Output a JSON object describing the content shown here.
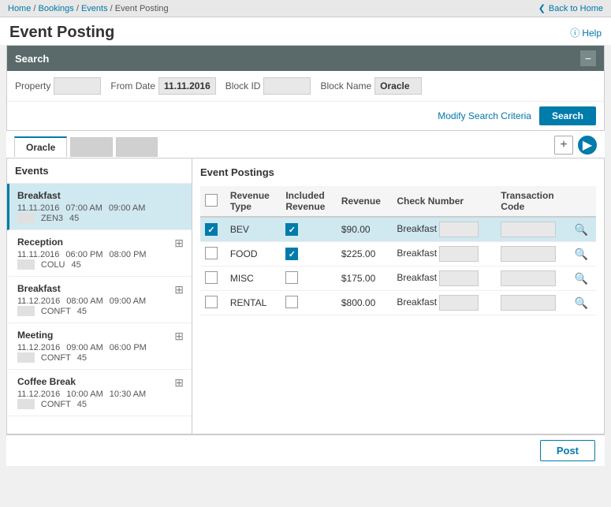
{
  "breadcrumb": {
    "items": [
      "Home",
      "Bookings",
      "Events",
      "Event Posting"
    ]
  },
  "back_to_home": "Back to Home",
  "page_title": "Event Posting",
  "help_label": "Help",
  "search_section": {
    "title": "Search",
    "property_label": "Property",
    "property_value": "",
    "from_date_label": "From Date",
    "from_date_value": "11.11.2016",
    "block_id_label": "Block ID",
    "block_id_value": "",
    "block_name_label": "Block Name",
    "block_name_value": "Oracle",
    "modify_link": "Modify Search Criteria",
    "search_btn": "Search"
  },
  "tabs": [
    {
      "label": "Oracle",
      "active": true
    },
    {
      "label": "",
      "active": false
    },
    {
      "label": "",
      "active": false
    }
  ],
  "events_title": "Events",
  "events": [
    {
      "name": "Breakfast",
      "date": "11.11.2016",
      "start_time": "07:00 AM",
      "end_time": "09:00 AM",
      "code": "ZEN3",
      "num": "45",
      "active": true,
      "has_icon": false
    },
    {
      "name": "Reception",
      "date": "11.11.2016",
      "start_time": "06:00 PM",
      "end_time": "08:00 PM",
      "code": "COLU",
      "num": "45",
      "active": false,
      "has_icon": true
    },
    {
      "name": "Breakfast",
      "date": "11.12.2016",
      "start_time": "08:00 AM",
      "end_time": "09:00 AM",
      "code": "CONFT",
      "num": "45",
      "active": false,
      "has_icon": true
    },
    {
      "name": "Meeting",
      "date": "11.12.2016",
      "start_time": "09:00 AM",
      "end_time": "06:00 PM",
      "code": "CONFT",
      "num": "45",
      "active": false,
      "has_icon": true
    },
    {
      "name": "Coffee Break",
      "date": "11.12.2016",
      "start_time": "10:00 AM",
      "end_time": "10:30 AM",
      "code": "CONFT",
      "num": "45",
      "active": false,
      "has_icon": true
    }
  ],
  "postings_title": "Event Postings",
  "postings_columns": [
    "",
    "Revenue Type",
    "Included Revenue",
    "Revenue",
    "Check Number",
    "Transaction Code"
  ],
  "postings": [
    {
      "checked": true,
      "revenue_type": "BEV",
      "included_revenue_checked": true,
      "revenue": "$90.00",
      "check_number": "Breakfast",
      "check_number_extra": "",
      "transaction_code": "",
      "active": true
    },
    {
      "checked": false,
      "revenue_type": "FOOD",
      "included_revenue_checked": true,
      "revenue": "$225.00",
      "check_number": "Breakfast",
      "check_number_extra": "",
      "transaction_code": "",
      "active": false
    },
    {
      "checked": false,
      "revenue_type": "MISC",
      "included_revenue_checked": false,
      "revenue": "$175.00",
      "check_number": "Breakfast",
      "check_number_extra": "",
      "transaction_code": "",
      "active": false
    },
    {
      "checked": false,
      "revenue_type": "RENTAL",
      "included_revenue_checked": false,
      "revenue": "$800.00",
      "check_number": "Breakfast",
      "check_number_extra": "",
      "transaction_code": "",
      "active": false
    }
  ],
  "post_btn_label": "Post"
}
